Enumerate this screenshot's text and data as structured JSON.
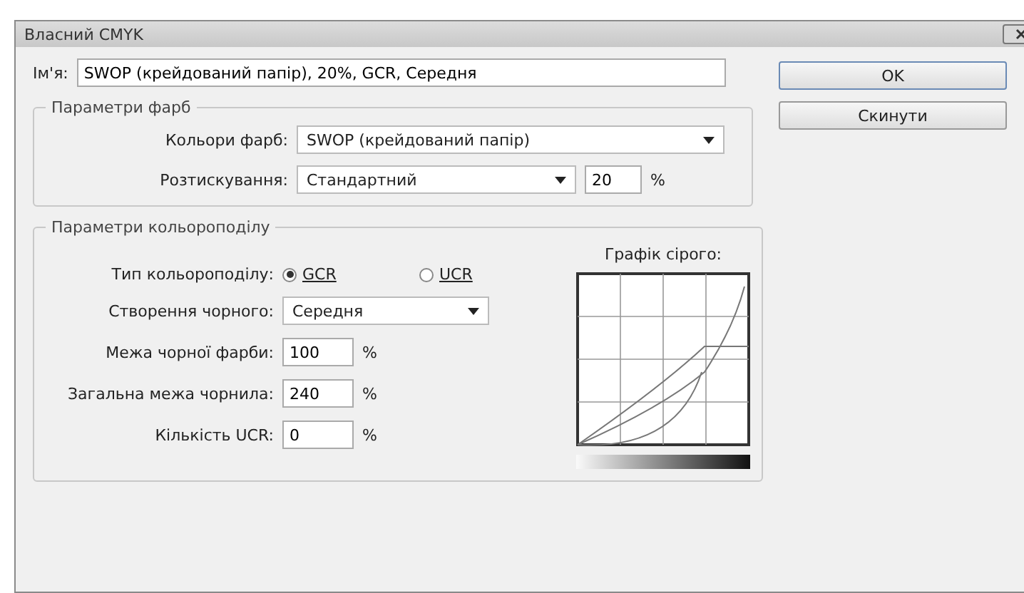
{
  "window": {
    "title": "Власний CMYK"
  },
  "name_field": {
    "label": "Ім'я:",
    "value": "SWOP (крейдований папір), 20%, GCR, Середня"
  },
  "buttons": [
    {
      "label": "OK",
      "default": true
    },
    {
      "label": "Скинути",
      "default": false
    }
  ],
  "ink_options": {
    "title": "Параметри фарб",
    "ink_colors": {
      "label": "Кольори фарб:",
      "value": "SWOP (крейдований папір)"
    },
    "dot_gain": {
      "label": "Розтискування:",
      "value": "Стандартний",
      "amount": "20",
      "unit": "%"
    }
  },
  "separation_options": {
    "title": "Параметри кольороподілу",
    "type": {
      "label": "Тип кольороподілу:",
      "options": [
        {
          "label": "GCR",
          "selected": true
        },
        {
          "label": "UCR",
          "selected": false
        }
      ]
    },
    "black_generation": {
      "label": "Створення чорного:",
      "value": "Середня"
    },
    "fields": [
      {
        "label": "Межа чорної фарби:",
        "value": "100",
        "unit": "%"
      },
      {
        "label": "Загальна межа чорнила:",
        "value": "240",
        "unit": "%"
      },
      {
        "label": "Кількість UCR:",
        "value": "0",
        "unit": "%"
      }
    ],
    "gray_ramp": {
      "title": "Графік сірого:"
    }
  }
}
